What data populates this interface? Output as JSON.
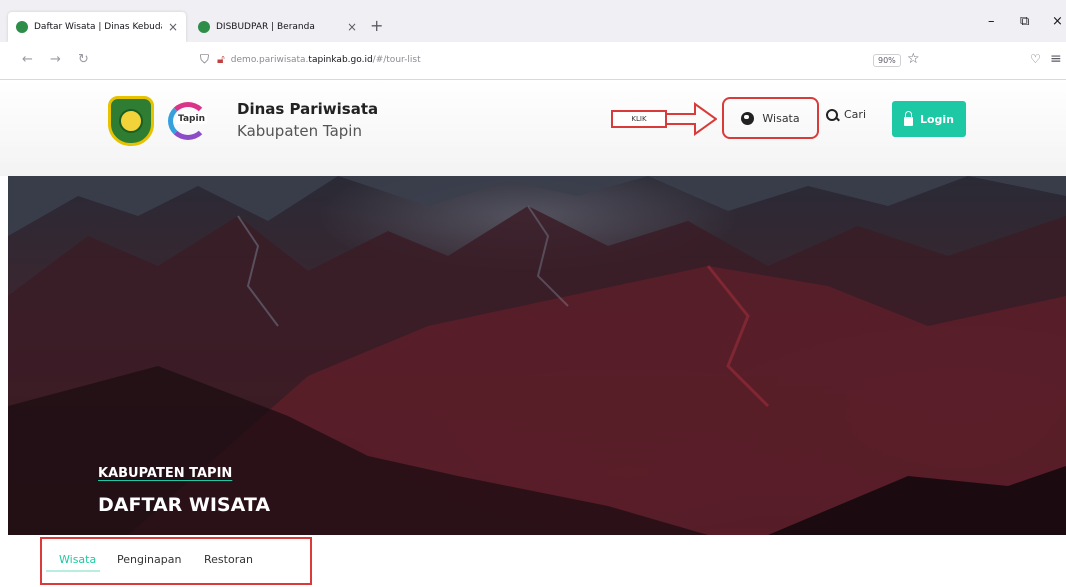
{
  "browser": {
    "tabs": [
      {
        "title": "Daftar Wisata | Dinas Kebudaya",
        "active": true
      },
      {
        "title": "DISBUDPAR | Beranda",
        "active": false
      }
    ],
    "close_glyph": "×",
    "new_tab_glyph": "+",
    "window_controls": [
      "–",
      "⧉",
      "×"
    ],
    "nav_icons": [
      "←",
      "→",
      "↻"
    ],
    "url_prefix": "demo.pariwisata.",
    "url_host": "tapinkab.go.id",
    "url_path": "/#/tour-list",
    "zoom": "90%",
    "star_glyph": "☆",
    "pocket_glyph": "♡",
    "menu_glyph": "≡"
  },
  "header": {
    "title": "Dinas Pariwisata",
    "subtitle": "Kabupaten Tapin",
    "logo_word": "Tapin",
    "annotation_label": "KLIK",
    "nav": {
      "wisata": "Wisata",
      "cari": "Cari",
      "login": "Login"
    },
    "accent_color": "#1dc9a4",
    "annotation_color": "#d93b3b"
  },
  "hero": {
    "kicker": "KABUPATEN TAPIN",
    "title": "DAFTAR WISATA"
  },
  "categories": {
    "tabs": [
      "Wisata",
      "Penginapan",
      "Restoran"
    ],
    "active": "Wisata"
  }
}
